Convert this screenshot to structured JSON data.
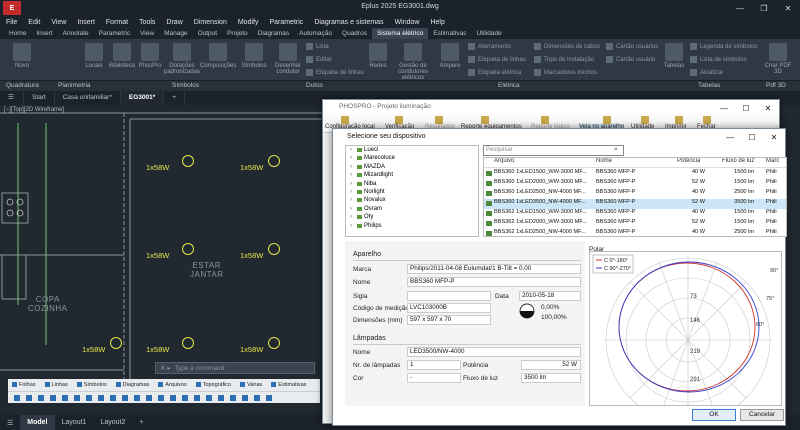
{
  "window": {
    "title": "Eplus 2025    EG3001.dwg"
  },
  "menu": [
    "File",
    "Edit",
    "View",
    "Insert",
    "Format",
    "Tools",
    "Draw",
    "Dimension",
    "Modify",
    "Parametric",
    "Diagramas e sistemas",
    "Window",
    "Help"
  ],
  "ribbon_tabs": [
    {
      "label": "Home",
      "active": false
    },
    {
      "label": "Insert",
      "active": false
    },
    {
      "label": "Annotate",
      "active": false
    },
    {
      "label": "Parametric",
      "active": false
    },
    {
      "label": "View",
      "active": false
    },
    {
      "label": "Manage",
      "active": false
    },
    {
      "label": "Output",
      "active": false
    },
    {
      "label": "Projeto",
      "active": false
    },
    {
      "label": "Diagramas",
      "active": false
    },
    {
      "label": "Automação",
      "active": false
    },
    {
      "label": "Quadros",
      "active": false
    },
    {
      "label": "Sistema elétrico",
      "active": true
    },
    {
      "label": "Estimativas",
      "active": false
    },
    {
      "label": "Utilidade",
      "active": false
    }
  ],
  "ribbon_tools": {
    "novo": "Novo",
    "locais": "Locais",
    "biblioteca": "Biblioteca",
    "phospro": "PhosPro",
    "dotacoes": "Dotações\npadronizadas",
    "composicoes": "Composições",
    "simbolos": "Símbolos",
    "desenhar_condutor": "Desenhar\ncondutor",
    "lista": "Lista",
    "editar": "Editar",
    "etiqueta_linhas": "Etiqueta de linhas",
    "redes": "Redes",
    "gestao": "Gestão de\ncondutores elétricos",
    "ampere": "Ampere",
    "aterramento": "Aterramento",
    "etiqueta_linhas2": "Etiqueta de linhas",
    "etiqueta_eletrica": "Etiqueta elétrica",
    "dimensoes": "Dimensões de cabos",
    "topo_instalacao": "Topo de instalação",
    "marcadores": "Marcadores trechos",
    "cartao_usuarios": "Cartão usuários",
    "cartao_usuario": "Cartão usuário",
    "tabelas": "Tabelas",
    "legenda": "Legenda de símbolos",
    "lista_simbolos": "Lista de símbolos",
    "atualizar": "Atualizar",
    "criar_pdf": "Criar PDF\n3D"
  },
  "ribbon_panels": [
    "Quadratura",
    "Planimetria",
    "Símbolos",
    "Dutos",
    "Elétrica",
    "Tabelas",
    "Pdf 3D"
  ],
  "doc_tabs": [
    {
      "label": "Start",
      "active": false
    },
    {
      "label": "Casa unifamiliar*",
      "active": false
    },
    {
      "label": "EG3001*",
      "active": true
    }
  ],
  "canvas": {
    "view_label": "[−][Top][2D Wireframe]",
    "lamp_label": "1x58W",
    "rooms": {
      "copa": "COPA\nCOZINHA",
      "estar": "ESTAR\nJANTAR"
    },
    "command_placeholder": "Type a command"
  },
  "toolbar_tabs": [
    "Folhas",
    "Linhas",
    "Símbolos",
    "Diagramas",
    "Arquivos",
    "Topográfico",
    "Varias",
    "Estimativas"
  ],
  "status_tabs": [
    {
      "label": "Model",
      "active": true
    },
    {
      "label": "Layout1",
      "active": false
    },
    {
      "label": "Layout2",
      "active": false
    }
  ],
  "phospro": {
    "title": "PHOSPRO - Projeto iluminação",
    "tools": [
      "Configuração local",
      "Verificação",
      "Resultados",
      "Reporte equipamentos",
      "Reporte lógico",
      "Veja no aparelho",
      "Utilidade",
      "Imprimir",
      "Fechar"
    ]
  },
  "dialog": {
    "title": "Selecione seu dispositivo",
    "search_placeholder": "Pesquisar",
    "manufacturers": [
      "Lueci",
      "Marecoluce",
      "MAZDA",
      "Mizardlight",
      "Niba",
      "Norlight",
      "Novalux",
      "Osram",
      "Oty",
      "Philips"
    ],
    "columns": [
      "Arquivo",
      "Nome",
      "Potência",
      "Fluxo de luz",
      "Marc"
    ],
    "rows": [
      [
        "BBS360 1xLED1500_WW-3000 MF...",
        "BBS360 MFP-P",
        "40 W",
        "1500 lm",
        "Phili"
      ],
      [
        "BBS360 1xLED2000_WW-3000 MF...",
        "BBS360 MFP-P",
        "52 W",
        "1500 lm",
        "Phili"
      ],
      [
        "BBS360 1xLED2500_NW-4000 MF...",
        "BBS360 MFP-P",
        "40 W",
        "2500 lm",
        "Phili"
      ],
      [
        "BBS360 1xLED3500_NW-4000 MF...",
        "BBS360 MFP-P",
        "52 W",
        "3500 lm",
        "Phili"
      ],
      [
        "BBS362 1xLED1500_WW-3000 MF...",
        "BBS360 MFP-P",
        "40 W",
        "1500 lm",
        "Phili"
      ],
      [
        "BBS362 1xLED2000_WW-3000 MF...",
        "BBS360 MFP-P",
        "52 W",
        "1500 lm",
        "Phili"
      ],
      [
        "BBS362 1xLED2500_NW-4000 MF...",
        "BBS360 MFP-P",
        "40 W",
        "2500 lm",
        "Phili"
      ],
      [
        "BBS362 1xLED3500_NW-4000 MF...",
        "BBS360 MFP-P",
        "52 W",
        "3500 lm",
        "Phili"
      ]
    ],
    "selected_row": 3,
    "aparelho": {
      "section": "Aparelho",
      "marca_label": "Marca",
      "marca": "Philips/2011-04-08 Eulumdat/1   B-Tilt = 0.00",
      "nome_label": "Nome",
      "nome": "BBS360 MFP-P",
      "sigla_label": "Sigla",
      "sigla": "",
      "data_label": "Data",
      "data": "2010-05-18",
      "codigo_label": "Código de medição",
      "codigo": "LVC103000B",
      "dim_label": "Dimensões (mm)",
      "dim": "597 x 597 x 70",
      "pct1": "0,00%",
      "pct2": "100,00%"
    },
    "lampadas": {
      "section": "Lâmpadas",
      "nome_label": "Nome",
      "nome": "LED3500/NW-4000",
      "nr_label": "Nr. de lâmpadas",
      "nr": "1",
      "potencia_label": "Potência",
      "potencia": "52 W",
      "cor_label": "Cor",
      "cor": "-",
      "fluxo_label": "Fluxo de luz",
      "fluxo": "3500 lm"
    },
    "polar": {
      "tab": "Polar",
      "legend": [
        "C 0°-180°",
        "C 90°-270°"
      ],
      "ring_values": [
        "73",
        "146",
        "219",
        "291"
      ],
      "angle_labels": [
        "90°",
        "75°",
        "60°"
      ],
      "colors": {
        "c0": "#d03030",
        "c90": "#3040d0"
      }
    },
    "ok": "OK",
    "cancel": "Cancelar"
  }
}
